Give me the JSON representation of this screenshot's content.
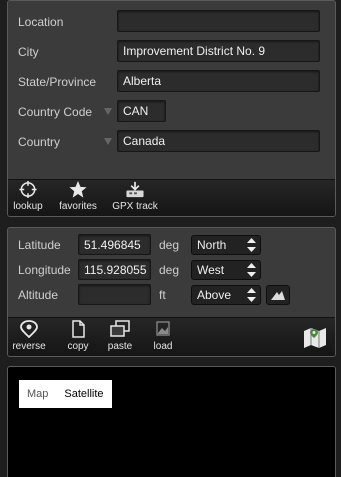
{
  "location": {
    "fields": [
      {
        "label": "Location",
        "value": ""
      },
      {
        "label": "City",
        "value": "Improvement District No. 9"
      },
      {
        "label": "State/Province",
        "value": "Alberta"
      },
      {
        "label": "Country Code",
        "value": "CAN"
      },
      {
        "label": "Country",
        "value": "Canada"
      }
    ],
    "toolbar": [
      {
        "label": "lookup",
        "icon": "crosshair-icon"
      },
      {
        "label": "favorites",
        "icon": "star-icon"
      },
      {
        "label": "GPX track",
        "icon": "gpx-track-icon"
      }
    ]
  },
  "coordinates": {
    "latitude": {
      "label": "Latitude",
      "value": "51.496845",
      "unit": "deg",
      "ref": "North"
    },
    "longitude": {
      "label": "Longitude",
      "value": "115.928055",
      "unit": "deg",
      "ref": "West"
    },
    "altitude": {
      "label": "Altitude",
      "value": "",
      "unit": "ft",
      "ref": "Above"
    },
    "toolbar": [
      {
        "label": "reverse",
        "icon": "location-pin-icon"
      },
      {
        "label": "copy",
        "icon": "copy-icon"
      },
      {
        "label": "paste",
        "icon": "paste-icon"
      },
      {
        "label": "load",
        "icon": "load-image-icon"
      }
    ]
  },
  "map": {
    "types": [
      "Map",
      "Satellite"
    ],
    "selected": "Satellite"
  }
}
